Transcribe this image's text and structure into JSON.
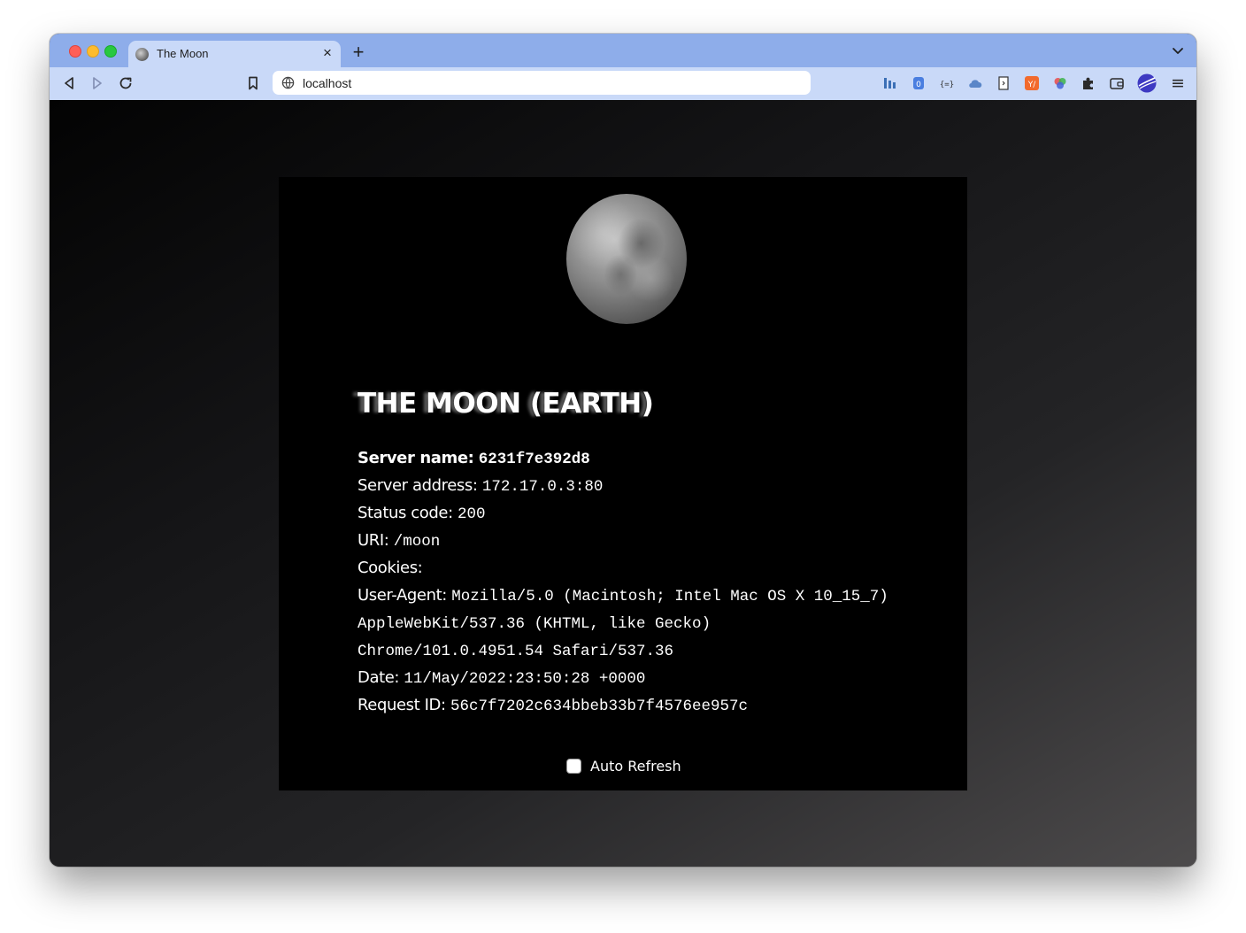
{
  "browser": {
    "tab_title": "The Moon",
    "tab_close": "×",
    "new_tab": "+",
    "address": "localhost",
    "extensions": [
      "chart-icon",
      "shield-icon",
      "json-icon",
      "cloud-icon",
      "document-icon",
      "translate-icon",
      "color-wheel-icon",
      "puzzle-icon",
      "wallet-icon",
      "profile-icon"
    ],
    "menu": "≡"
  },
  "page": {
    "heading": "THE MOON (EARTH)",
    "fields": [
      {
        "label": "Server name:",
        "value": "6231f7e392d8"
      },
      {
        "label": "Server address:",
        "value": "172.17.0.3:80"
      },
      {
        "label": "Status code:",
        "value": "200"
      },
      {
        "label": "URI:",
        "value": "/moon"
      },
      {
        "label": "Cookies:",
        "value": ""
      },
      {
        "label": "User-Agent:",
        "value": "Mozilla/5.0 (Macintosh; Intel Mac OS X 10_15_7) AppleWebKit/537.36 (KHTML, like Gecko) Chrome/101.0.4951.54 Safari/537.36"
      },
      {
        "label": "Date:",
        "value": "11/May/2022:23:50:28 +0000"
      },
      {
        "label": "Request ID:",
        "value": "56c7f7202c634bbeb33b7f4576ee957c"
      }
    ],
    "auto_refresh": {
      "label": "Auto Refresh",
      "checked": false
    }
  }
}
